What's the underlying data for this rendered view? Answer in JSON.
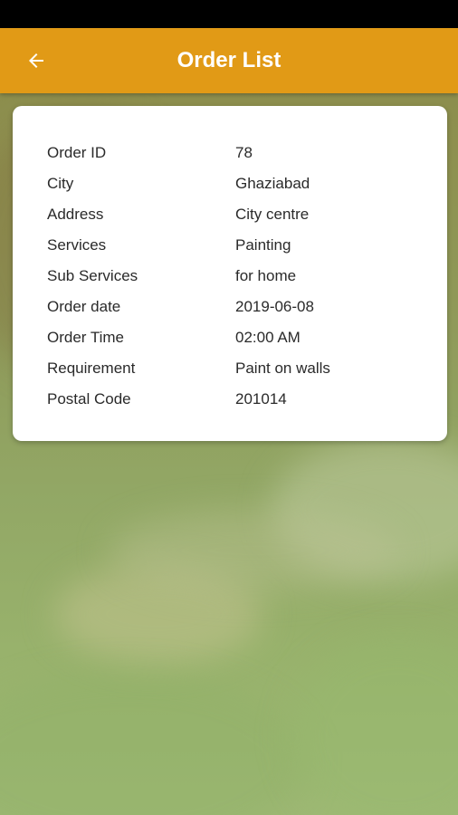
{
  "app_bar": {
    "title": "Order List",
    "back_icon": "arrow-back-icon",
    "color": "#e19a16"
  },
  "order": {
    "rows": [
      {
        "label": "Order ID",
        "value": "78"
      },
      {
        "label": "City",
        "value": "Ghaziabad"
      },
      {
        "label": "Address",
        "value": "City centre"
      },
      {
        "label": "Services",
        "value": "Painting"
      },
      {
        "label": "Sub Services",
        "value": "for home"
      },
      {
        "label": "Order date",
        "value": "2019-06-08"
      },
      {
        "label": "Order Time",
        "value": "02:00 AM"
      },
      {
        "label": "Requirement",
        "value": "Paint on walls"
      },
      {
        "label": "Postal Code",
        "value": "201014"
      }
    ]
  }
}
